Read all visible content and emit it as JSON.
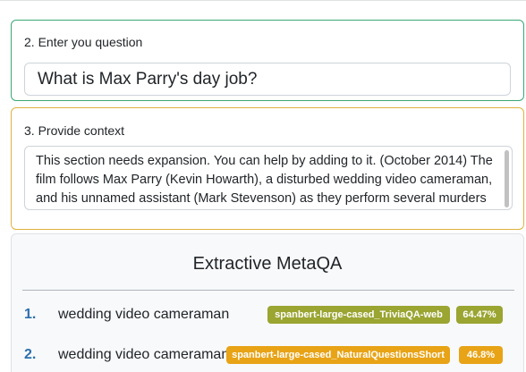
{
  "question_section": {
    "label": "2. Enter you question",
    "value": "What is Max Parry's day job?"
  },
  "context_section": {
    "label": "3. Provide context",
    "value": "This section needs expansion. You can help by adding to it. (October 2014) The film follows Max Parry (Kevin Howarth), a disturbed wedding video cameraman, and his unnamed assistant (Mark Stevenson) as they perform several murders ..."
  },
  "results": {
    "title": "Extractive MetaQA",
    "items": [
      {
        "rank": "1.",
        "answer": "wedding video cameraman",
        "model": "spanbert-large-cased_TriviaQA-web",
        "score": "64.47%",
        "color": "#9aa532"
      },
      {
        "rank": "2.",
        "answer": "wedding video cameraman",
        "model": "spanbert-large-cased_NaturalQuestionsShort",
        "score": "46.8%",
        "color": "#e8a316"
      }
    ]
  }
}
